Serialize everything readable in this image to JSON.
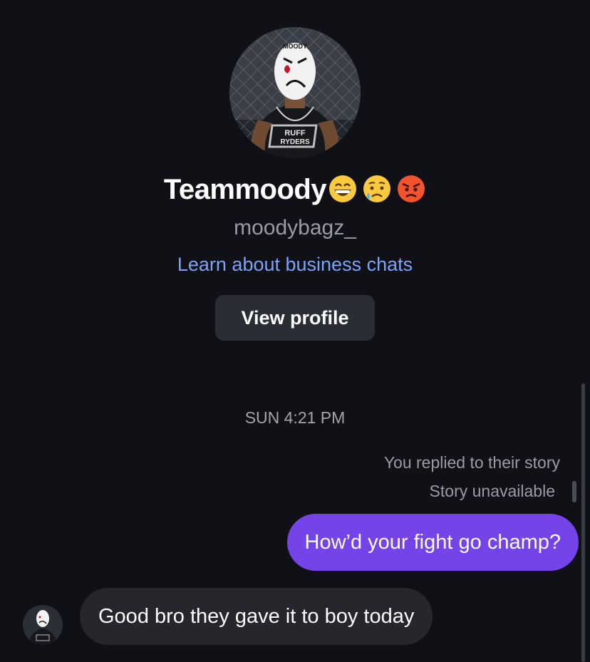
{
  "profile": {
    "display_name": "Teammoody",
    "display_name_emojis": [
      "grinning-face-emoji",
      "crying-face-emoji",
      "angry-face-emoji"
    ],
    "username": "moodybagz_",
    "business_link": "Learn about business chats",
    "view_profile_label": "View profile",
    "avatar_mask_text": "MOODY",
    "avatar_shirt_text": "RUFF RYDERS"
  },
  "conversation": {
    "timestamp": "SUN 4:21 PM",
    "reply_context": "You replied to their story",
    "story_status": "Story unavailable",
    "messages": [
      {
        "direction": "outgoing",
        "text": "How’d your fight go champ?"
      },
      {
        "direction": "incoming",
        "text": "Good bro they gave it to boy today"
      }
    ]
  },
  "colors": {
    "background": "#0f1116",
    "outgoing_bubble": "#7444e8",
    "incoming_bubble": "#25272d",
    "link": "#7ea2f5",
    "button": "#2a2d34"
  }
}
